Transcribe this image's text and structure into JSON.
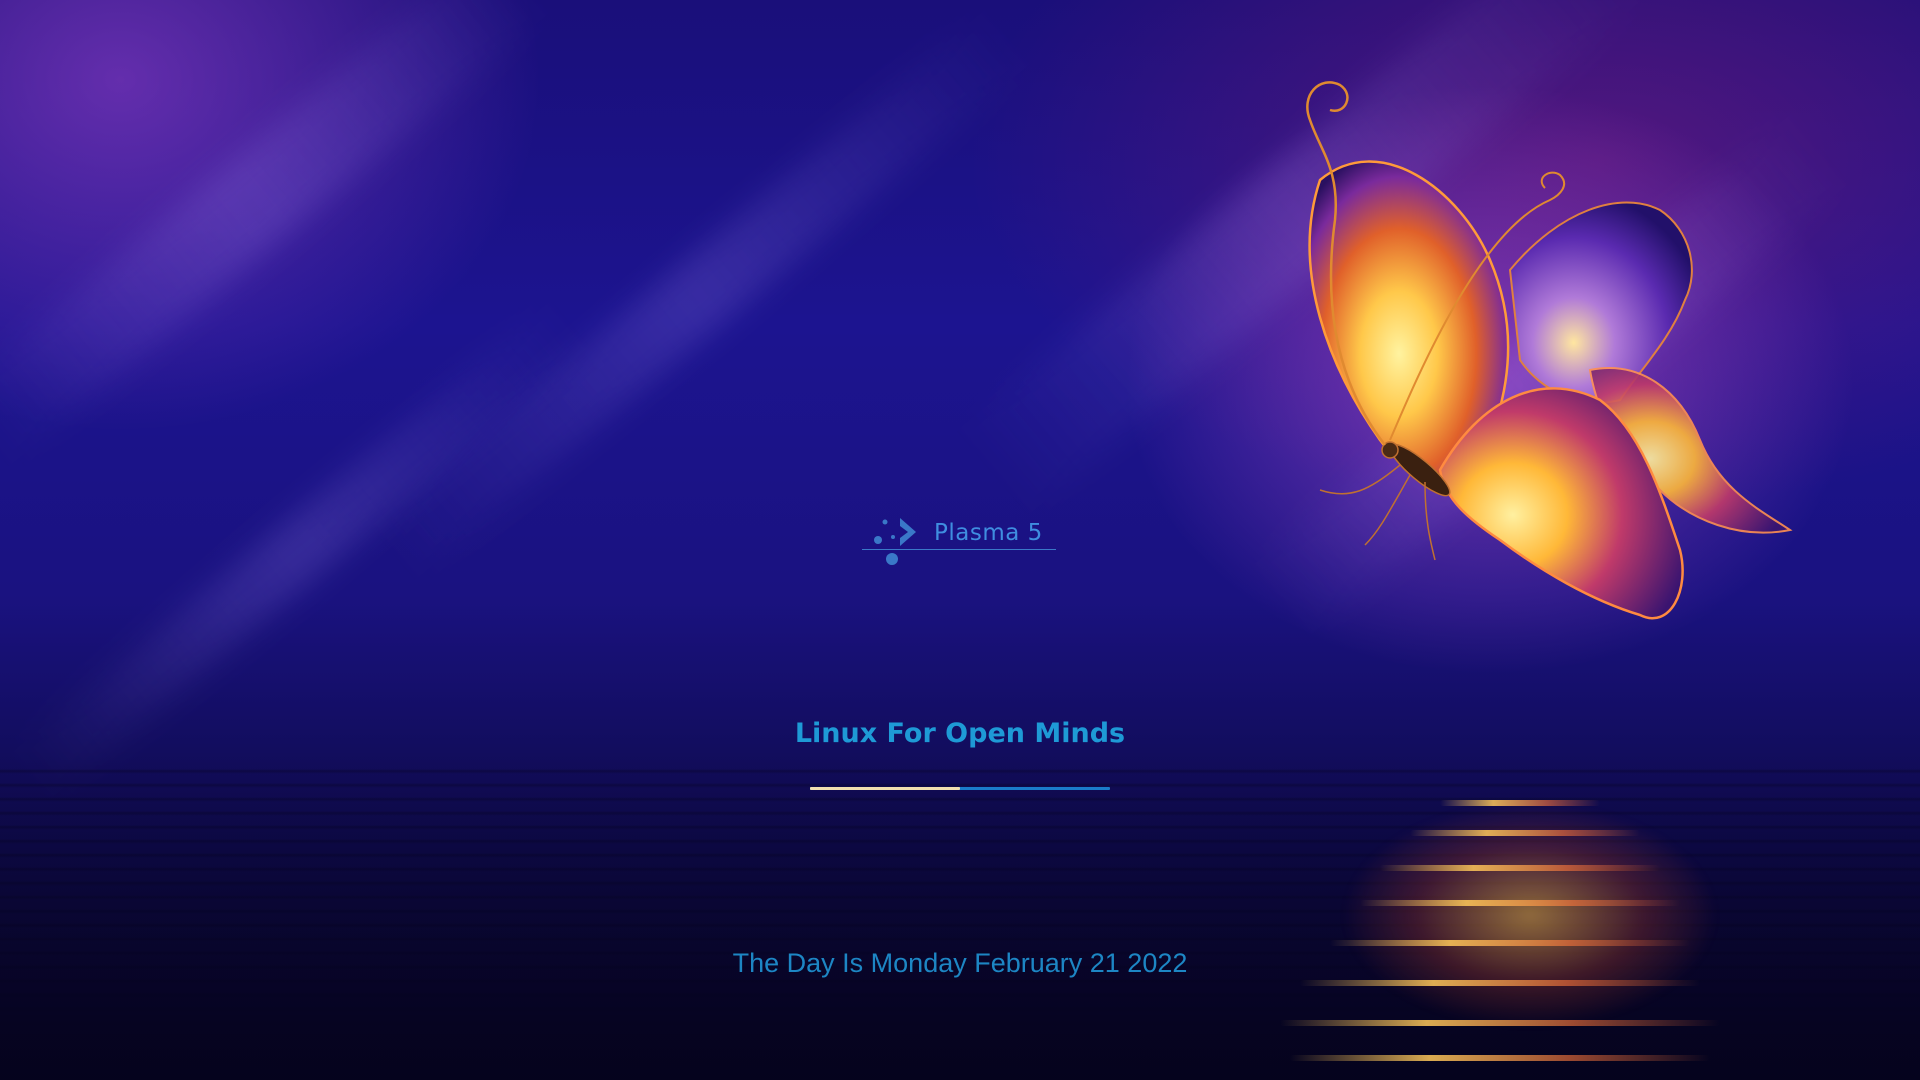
{
  "splash": {
    "logo_text": "Plasma 5",
    "logo_icon": "kde-plasma-logo-icon",
    "tagline": "Linux For Open Minds",
    "progress": 0.5,
    "date_text": "The Day Is Monday February 21 2022"
  },
  "wallpaper": {
    "subject": "butterfly-icon",
    "colors": {
      "background": "#1a1280",
      "wing_glow": "#ffc84a",
      "wing_edge": "#7a2a9c",
      "accent_text": "#1e9ad6",
      "progress_fill": "#f2e0b0",
      "progress_track": "#1a7cc9"
    }
  }
}
